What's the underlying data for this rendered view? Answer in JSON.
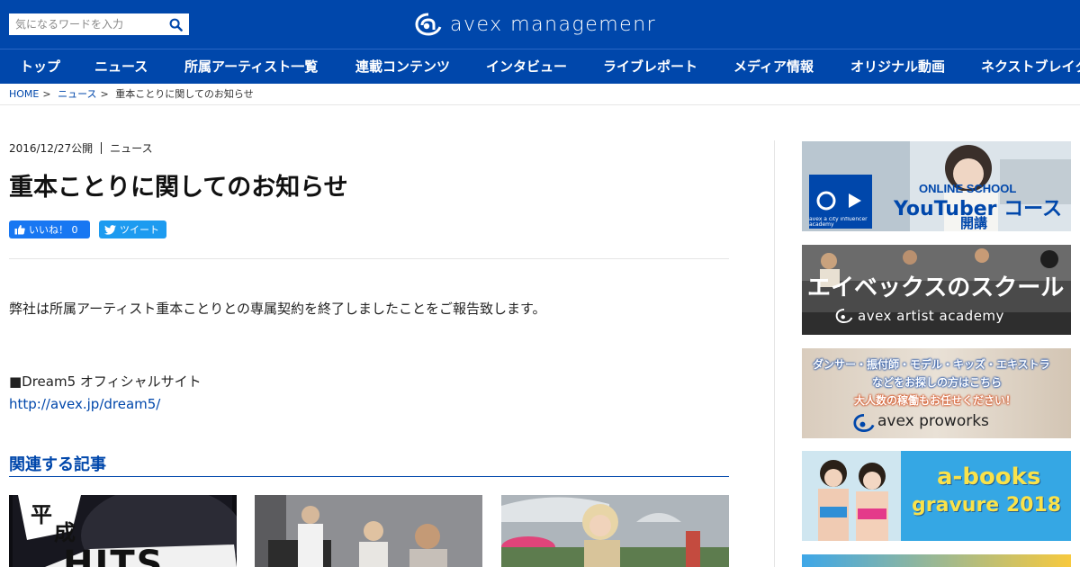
{
  "header": {
    "search_placeholder": "気になるワードを入力",
    "logo_text": "avex managemenr"
  },
  "nav": [
    {
      "label": "トップ"
    },
    {
      "label": "ニュース"
    },
    {
      "label": "所属アーティスト一覧"
    },
    {
      "label": "連載コンテンツ"
    },
    {
      "label": "インタビュー"
    },
    {
      "label": "ライブレポート"
    },
    {
      "label": "メディア情報"
    },
    {
      "label": "オリジナル動画"
    },
    {
      "label": "ネクストブレイク"
    }
  ],
  "breadcrumb": {
    "home": "HOME",
    "news": "ニュース",
    "current": "重本ことりに関してのお知らせ",
    "sep": ">"
  },
  "article": {
    "date": "2016/12/27公開",
    "category": "ニュース",
    "title": "重本ことりに関してのお知らせ",
    "like_label": "いいね！ 0",
    "tweet_label": "ツイート",
    "body": "弊社は所属アーティスト重本ことりとの専属契約を終了しましたことをご報告致します。",
    "official_label": "■Dream5 オフィシャルサイト",
    "official_url": "http://avex.jp/dream5/"
  },
  "related": {
    "heading": "関連する記事",
    "card1_text_top": "平",
    "card1_text_mid": "成",
    "card1_text_bottom": "HITS"
  },
  "sidebar": {
    "banner1": {
      "line1": "ONLINE SCHOOL",
      "line2": "YouTuber コース",
      "line3": "開講",
      "small": "avex a city influencer academy"
    },
    "banner2": {
      "line1": "エイベックスのスクール",
      "line2": "avex artist academy"
    },
    "banner3": {
      "line1": "ダンサー・振付師・モデル・キッズ・エキストラ",
      "line2": "などをお探しの方はこちら",
      "line3": "大人数の稼働もお任せください！",
      "line4": "avex proworks"
    },
    "banner4": {
      "line1": "a-books",
      "line2": "gravure 2018"
    }
  },
  "colors": {
    "brand": "#0047ab",
    "facebook": "#1877f2",
    "twitter": "#1d9bf0"
  }
}
